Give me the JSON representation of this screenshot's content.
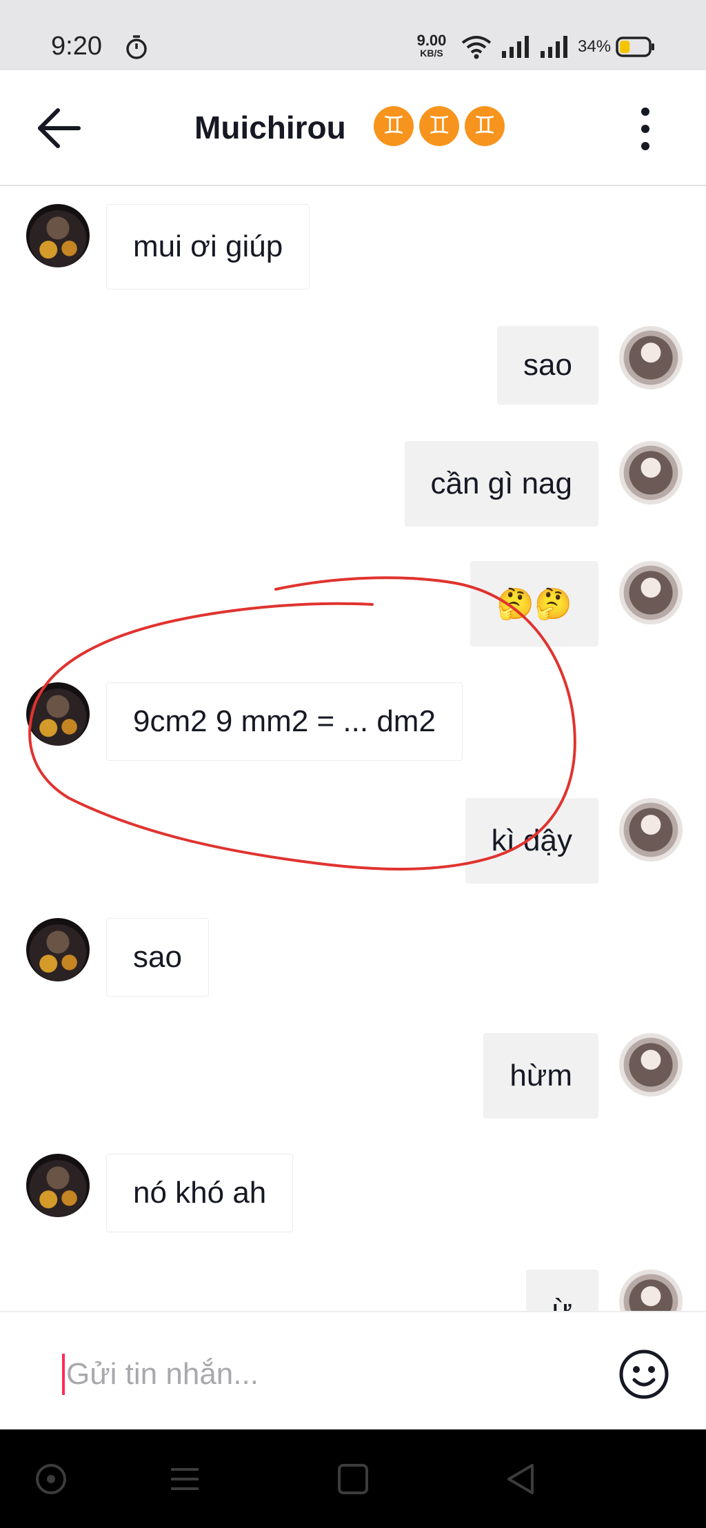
{
  "status_bar": {
    "time": "9:20",
    "net_speed_value": "9.00",
    "net_speed_unit": "KB/S",
    "battery_percent": "34%",
    "battery_level": 0.34,
    "battery_color": "#f5c400",
    "icons": [
      "timer-icon",
      "wifi-icon",
      "signal-icon",
      "signal-icon",
      "battery-icon"
    ]
  },
  "header": {
    "title": "Muichirou",
    "title_emojis": [
      "♊",
      "♊",
      "♊"
    ],
    "back_icon": "arrow-left-icon",
    "more_icon": "more-vertical-icon"
  },
  "messages": [
    {
      "side": "in",
      "text": "mui ơi giúp"
    },
    {
      "side": "out",
      "text": "sao"
    },
    {
      "side": "out",
      "text": "cần gì nag"
    },
    {
      "side": "out",
      "text": "🤔🤔"
    },
    {
      "side": "in",
      "text": "9cm2 9 mm2 = ... dm2"
    },
    {
      "side": "out",
      "text": "kì dậy"
    },
    {
      "side": "in",
      "text": "sao"
    },
    {
      "side": "out",
      "text": "hừm"
    },
    {
      "side": "in",
      "text": "nó khó ah"
    },
    {
      "side": "out",
      "text": "ừ"
    }
  ],
  "composer": {
    "placeholder": "Gửi tin nhắn...",
    "value": "",
    "emoji_icon": "smiley-icon",
    "accent_color": "#fe2c55"
  },
  "annotation_color": "#e0332f",
  "nav_bar": {
    "icons": [
      "circle-home-icon",
      "menu-icon",
      "square-recents-icon",
      "triangle-back-icon"
    ]
  }
}
